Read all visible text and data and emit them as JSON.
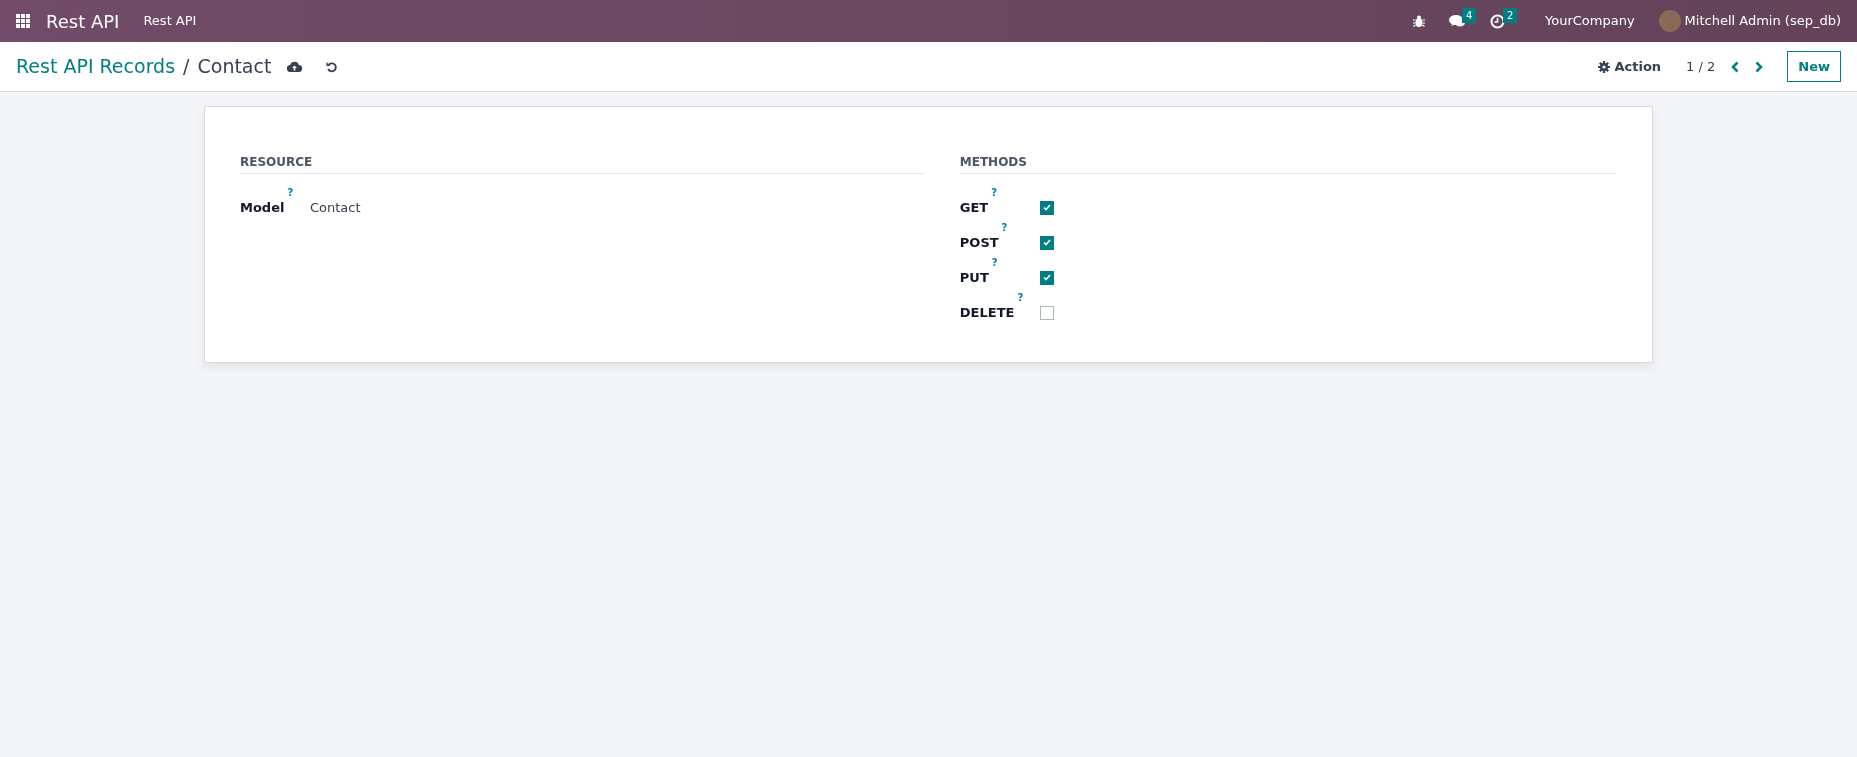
{
  "navbar": {
    "app_name": "Rest API",
    "menu": [
      "Rest API"
    ],
    "messages_count": "4",
    "activities_count": "2",
    "company": "YourCompany",
    "user": "Mitchell Admin (sep_db)"
  },
  "control_panel": {
    "breadcrumb_parent": "Rest API Records",
    "separator": "/",
    "breadcrumb_current": "Contact",
    "action": "Action",
    "pager": "1 / 2",
    "new_button": "New"
  },
  "form": {
    "resource": {
      "heading": "RESOURCE",
      "fields": [
        {
          "label": "Model",
          "help": "?",
          "value": "Contact"
        }
      ]
    },
    "methods": {
      "heading": "METHODS",
      "fields": [
        {
          "label": "GET",
          "help": "?",
          "checked": true
        },
        {
          "label": "POST",
          "help": "?",
          "checked": true
        },
        {
          "label": "PUT",
          "help": "?",
          "checked": true
        },
        {
          "label": "DELETE",
          "help": "?",
          "checked": false
        }
      ]
    }
  }
}
